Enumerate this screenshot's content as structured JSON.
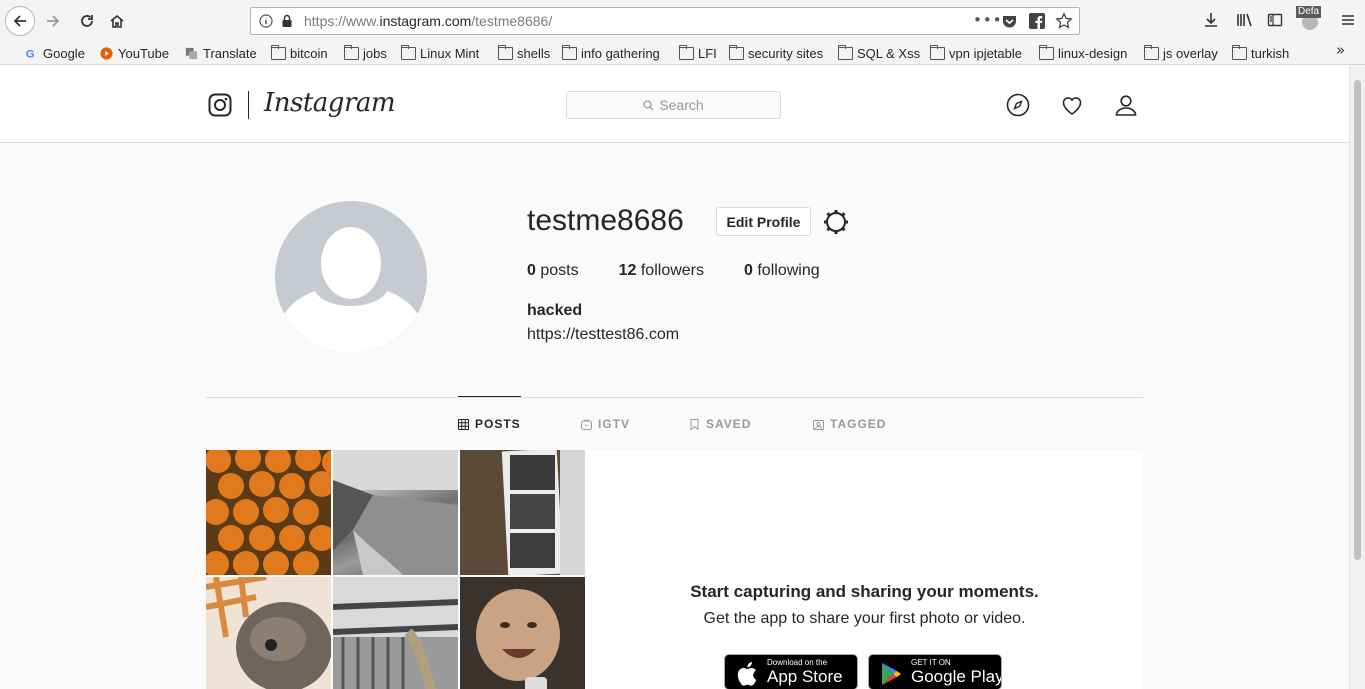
{
  "browser": {
    "url_prefix": "https://www.",
    "url_domain": "instagram.com",
    "url_path": "/testme8686/",
    "page_actions": "•••",
    "profile_badge": "Defa",
    "bookmarks": [
      {
        "label": "Google",
        "icon": "google-icon"
      },
      {
        "label": "YouTube",
        "icon": "youtube-icon"
      },
      {
        "label": "Translate",
        "icon": "translate-icon"
      },
      {
        "label": "bitcoin",
        "icon": "folder-icon"
      },
      {
        "label": "jobs",
        "icon": "folder-icon"
      },
      {
        "label": "Linux Mint",
        "icon": "folder-icon"
      },
      {
        "label": "shells",
        "icon": "folder-icon"
      },
      {
        "label": "info gathering",
        "icon": "folder-icon"
      },
      {
        "label": "LFI",
        "icon": "folder-icon"
      },
      {
        "label": "security sites",
        "icon": "folder-icon"
      },
      {
        "label": "SQL & Xss",
        "icon": "folder-icon"
      },
      {
        "label": "vpn ipjetable",
        "icon": "folder-icon"
      },
      {
        "label": "linux-design",
        "icon": "folder-icon"
      },
      {
        "label": "js overlay",
        "icon": "folder-icon"
      },
      {
        "label": "turkish",
        "icon": "folder-icon"
      }
    ],
    "overflow": "»"
  },
  "header": {
    "wordmark": "Instagram",
    "search_placeholder": "Search"
  },
  "profile": {
    "username": "testme8686",
    "edit_button": "Edit Profile",
    "stats": {
      "posts_count": "0",
      "posts_label": "posts",
      "followers_count": "12",
      "followers_label": "followers",
      "following_count": "0",
      "following_label": "following"
    },
    "full_name": "hacked",
    "website": "https://testtest86.com"
  },
  "tabs": [
    {
      "label": "POSTS",
      "active": true
    },
    {
      "label": "IGTV",
      "active": false
    },
    {
      "label": "SAVED",
      "active": false
    },
    {
      "label": "TAGGED",
      "active": false
    }
  ],
  "promo": {
    "title": "Start capturing and sharing your moments.",
    "subtitle": "Get the app to share your first photo or video.",
    "appstore_small": "Download on the",
    "appstore_big": "App Store",
    "googleplay_small": "GET IT ON",
    "googleplay_big": "Google Play"
  },
  "colors": {
    "accent_text": "#262626",
    "muted_text": "#999999",
    "border": "#dbdbdb",
    "tile_orange": "#e07a1c"
  }
}
